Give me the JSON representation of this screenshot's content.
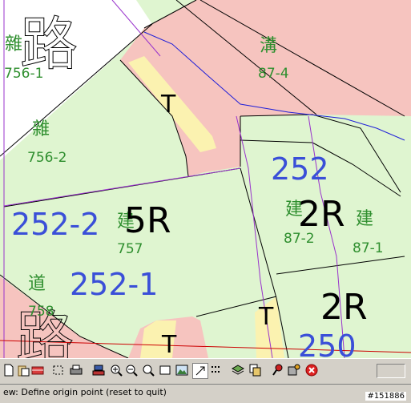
{
  "map": {
    "colors": {
      "green": "#dff5d0",
      "pink": "#f6c4bf",
      "yellow": "#fbf2b0",
      "white": "#ffffff",
      "purple": "#9933cc",
      "blue": "#1f1fd8",
      "black": "#000000",
      "red": "#cc0000",
      "textGreen": "#2f8f2f",
      "textBlue": "#3a4fd8"
    },
    "labels": {
      "road_char": "路",
      "road_char2": "路",
      "c_za1": "雜",
      "c_za1_num": "756-1",
      "c_gou": "溝",
      "c_gou_num": "87-4",
      "c_za2": "雜",
      "c_za2_num": "756-2",
      "c_jian1": "建",
      "c_jian1_num": "757",
      "c_jian2": "建",
      "c_jian2_num": "87-2",
      "c_jian3": "建",
      "c_jian3_num": "87-1",
      "c_dao": "道",
      "c_dao_num": "758",
      "z_5r": "5R",
      "z_2r_a": "2R",
      "z_2r_b": "2R",
      "lot_252": "252",
      "lot_252_2": "252-2",
      "lot_252_1": "252-1",
      "lot_250": "250",
      "t1": "T",
      "t2": "T",
      "t3": "T"
    }
  },
  "status": {
    "message": "ew: Define origin point (reset to quit)",
    "code": "#151886"
  },
  "toolbar": {
    "icons": [
      "new-page-icon",
      "paste-icon",
      "eraser-icon",
      "select-box-icon",
      "print-icon",
      "stamp-icon",
      "zoom-in-icon",
      "zoom-out-icon",
      "zoom-window-icon",
      "rectangle-icon",
      "image-icon",
      "arrow-icon",
      "grid-points-icon",
      "layers-icon",
      "copy-icon",
      "pin-icon",
      "pin-image-icon",
      "stop-icon"
    ]
  }
}
